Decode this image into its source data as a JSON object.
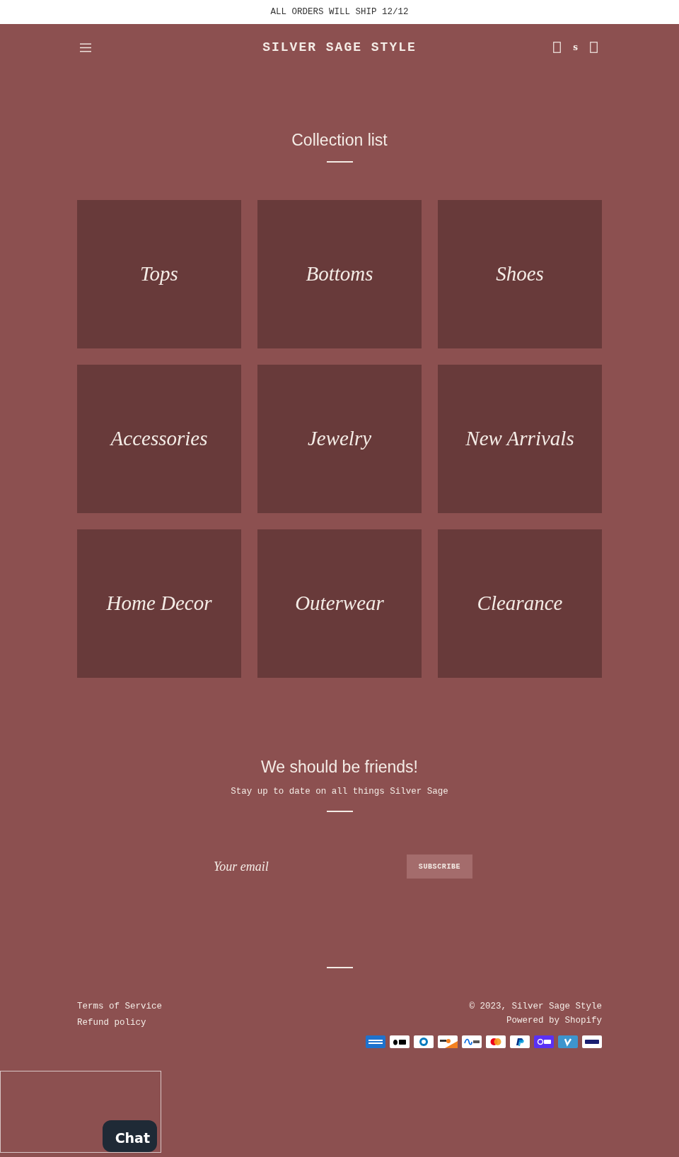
{
  "announcement_bar": {
    "text": "ALL ORDERS WILL SHIP 12/12"
  },
  "header": {
    "logo": "SILVER SAGE STYLE",
    "icon_text": "s"
  },
  "collection_list": {
    "title": "Collection list",
    "collections": [
      "Tops",
      "Bottoms",
      "Shoes",
      "Accessories",
      "Jewelry",
      "New Arrivals",
      "Home Decor",
      "Outerwear",
      "Clearance"
    ]
  },
  "newsletter": {
    "title": "We should be friends!",
    "subtitle": "Stay up to date on all things Silver Sage",
    "email": {
      "placeholder": "Your email"
    },
    "button": "SUBSCRIBE"
  },
  "footer": {
    "links": [
      "Terms of Service",
      "Refund policy"
    ],
    "copyright": "© 2023, Silver Sage Style",
    "powered_by": "Powered by Shopify"
  },
  "chat": {
    "button": "Chat"
  }
}
